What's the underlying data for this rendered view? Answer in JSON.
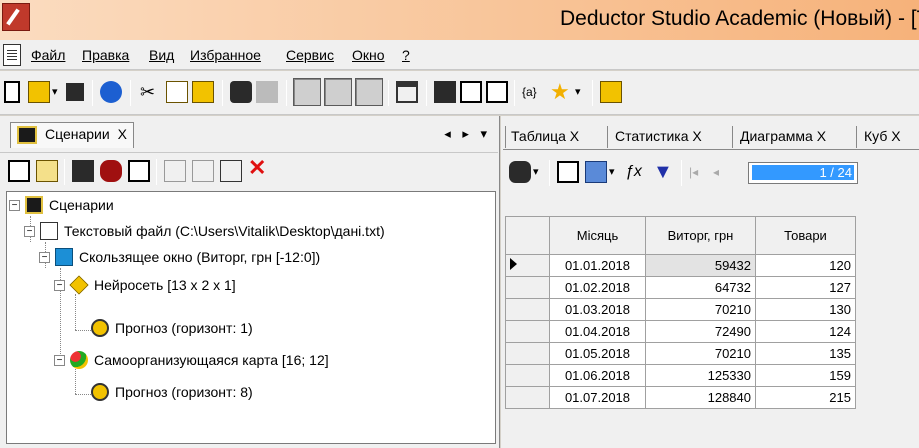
{
  "window": {
    "title": "Deductor Studio Academic (Новый) - [Т"
  },
  "menu": {
    "items": [
      "Файл",
      "Правка",
      "Вид",
      "Избранное",
      "Сервис",
      "Окно",
      "?"
    ]
  },
  "left_panel": {
    "tab_label": "Сценарии",
    "tab_close": "X",
    "nav": "◂ ▸ ▾",
    "tree": [
      {
        "label": "Сценарии",
        "icon": "scenario-icon"
      },
      {
        "label": "Текстовый файл (C:\\Users\\Vitalik\\Desktop\\дані.txt)",
        "icon": "text-file-icon"
      },
      {
        "label": "Скользящее окно (Виторг, грн [-12:0])",
        "icon": "sliding-window-icon"
      },
      {
        "label": "Нейросеть [13 x 2 x 1]",
        "icon": "neural-network-icon"
      },
      {
        "label": "Прогноз (горизонт: 1)",
        "icon": "forecast-icon"
      },
      {
        "label": "Самоорганизующаяся карта [16; 12]",
        "icon": "som-icon"
      },
      {
        "label": "Прогноз (горизонт: 8)",
        "icon": "forecast-icon"
      }
    ]
  },
  "right_panel": {
    "tabs": [
      {
        "label": "Таблица",
        "close": "X"
      },
      {
        "label": "Статистика",
        "close": "X"
      },
      {
        "label": "Диаграмма",
        "close": "X"
      },
      {
        "label": "Куб",
        "close": "X"
      }
    ],
    "page_indicator": "1 / 24",
    "table": {
      "columns": [
        "Місяць",
        "Виторг, грн",
        "Товари"
      ],
      "rows": [
        [
          "01.01.2018",
          "59432",
          "120"
        ],
        [
          "01.02.2018",
          "64732",
          "127"
        ],
        [
          "01.03.2018",
          "70210",
          "130"
        ],
        [
          "01.04.2018",
          "72490",
          "124"
        ],
        [
          "01.05.2018",
          "70210",
          "135"
        ],
        [
          "01.06.2018",
          "125330",
          "159"
        ],
        [
          "01.07.2018",
          "128840",
          "215"
        ]
      ]
    }
  },
  "colors": {
    "title_bar_start": "#fbdcc0",
    "title_bar_end": "#f6b27a",
    "selection": "#3399ff",
    "delete": "#e01010"
  }
}
